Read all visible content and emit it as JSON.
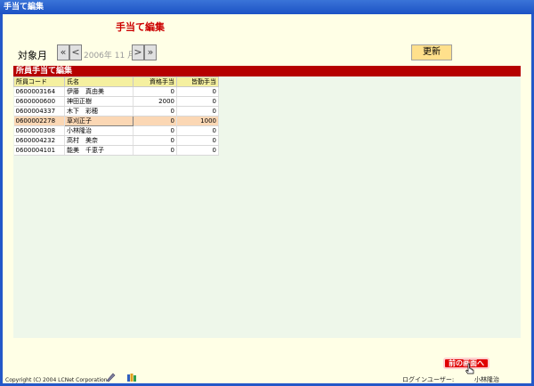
{
  "window": {
    "title": "手当て編集"
  },
  "page_title": "手当て編集",
  "month": {
    "label": "対象月",
    "value": "2006年 11 月",
    "first_btn": "«",
    "prev_btn": "<",
    "next_btn": ">",
    "last_btn": "»"
  },
  "update_button": "更新",
  "section_title": "所員手当て編集",
  "table": {
    "columns": [
      "所員コード",
      "氏名",
      "資格手当",
      "皆勤手当"
    ],
    "rows": [
      {
        "code": "0600003164",
        "name": "伊藤　真由美",
        "shikaku": "0",
        "kaikin": "0"
      },
      {
        "code": "0600000600",
        "name": "神田正樹",
        "shikaku": "2000",
        "kaikin": "0"
      },
      {
        "code": "0600004337",
        "name": "木下　彩穂",
        "shikaku": "0",
        "kaikin": "0"
      },
      {
        "code": "0600002278",
        "name": "草刈正子",
        "shikaku": "0",
        "kaikin": "1000"
      },
      {
        "code": "0600000308",
        "name": "小林隆治",
        "shikaku": "0",
        "kaikin": "0"
      },
      {
        "code": "0600004232",
        "name": "高村　美奈",
        "shikaku": "0",
        "kaikin": "0"
      },
      {
        "code": "0600004101",
        "name": "能美　千恵子",
        "shikaku": "0",
        "kaikin": "0"
      }
    ]
  },
  "footer": {
    "copyright": "Copyright (C) 2004 LCNet Corporation",
    "login_label": "ログインユーザー:",
    "login_user": "小林隆治",
    "back_button": "前の画面へ"
  },
  "colors": {
    "section": "#b50000",
    "selected_row": "#fbd7b4",
    "accent": "#cc0000"
  }
}
